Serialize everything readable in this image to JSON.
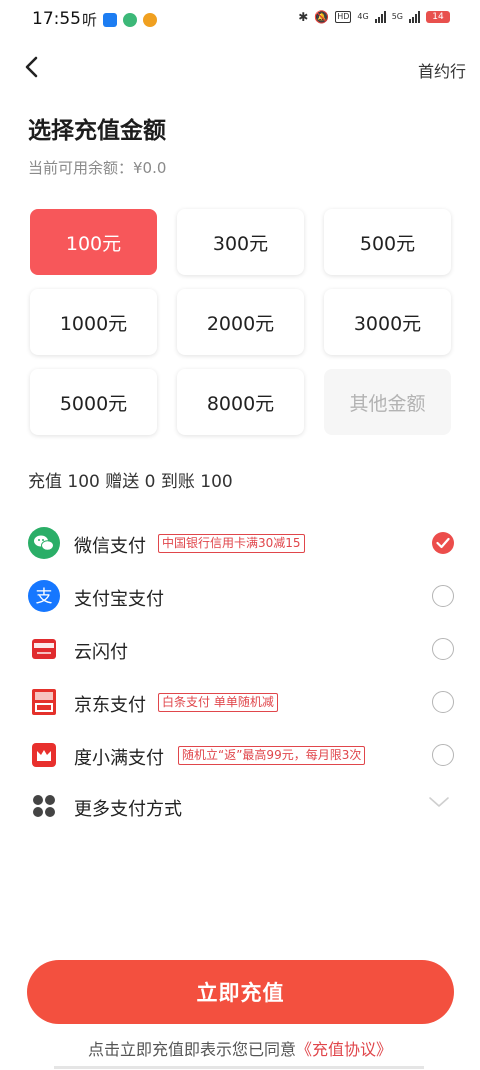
{
  "status_bar": {
    "time": "17:55",
    "ting": "听",
    "battery": "14",
    "hd": "HD",
    "net_4g": "4G",
    "net_5g": "5G"
  },
  "header": {
    "right_label": "首约行"
  },
  "title": "选择充值金额",
  "balance": {
    "label": "当前可用余额：",
    "value": "¥0.0"
  },
  "amounts": [
    {
      "label": "100元",
      "selected": true
    },
    {
      "label": "300元"
    },
    {
      "label": "500元"
    },
    {
      "label": "1000元"
    },
    {
      "label": "2000元"
    },
    {
      "label": "3000元"
    },
    {
      "label": "5000元"
    },
    {
      "label": "8000元"
    },
    {
      "label": "其他金额"
    }
  ],
  "summary": "充值 100 赠送 0 到账 100",
  "payments": [
    {
      "name": "微信支付",
      "promo": "中国银行信用卡满30减15",
      "checked": true,
      "icon": "wechat-pay-icon",
      "color": "#2aae67"
    },
    {
      "name": "支付宝支付",
      "promo": "",
      "checked": false,
      "icon": "alipay-icon",
      "color": "#1677ff"
    },
    {
      "name": "云闪付",
      "promo": "",
      "checked": false,
      "icon": "unionpay-quickpass-icon",
      "color": "#e02b2e"
    },
    {
      "name": "京东支付",
      "promo": "白条支付 单单随机减",
      "checked": false,
      "icon": "jd-pay-icon",
      "color": "#e4312b"
    },
    {
      "name": "度小满支付",
      "promo": "随机立“返”最高99元，每月限3次",
      "checked": false,
      "icon": "duxiaoman-pay-icon",
      "color": "#e8302d"
    }
  ],
  "more_payments": "更多支付方式",
  "submit_label": "立即充值",
  "agreement": {
    "prefix": "点击立即充值即表示您已同意",
    "link": "《充值协议》"
  },
  "colors": {
    "accent": "#f7575a",
    "button": "#f3503f",
    "promo": "#e0464b"
  }
}
